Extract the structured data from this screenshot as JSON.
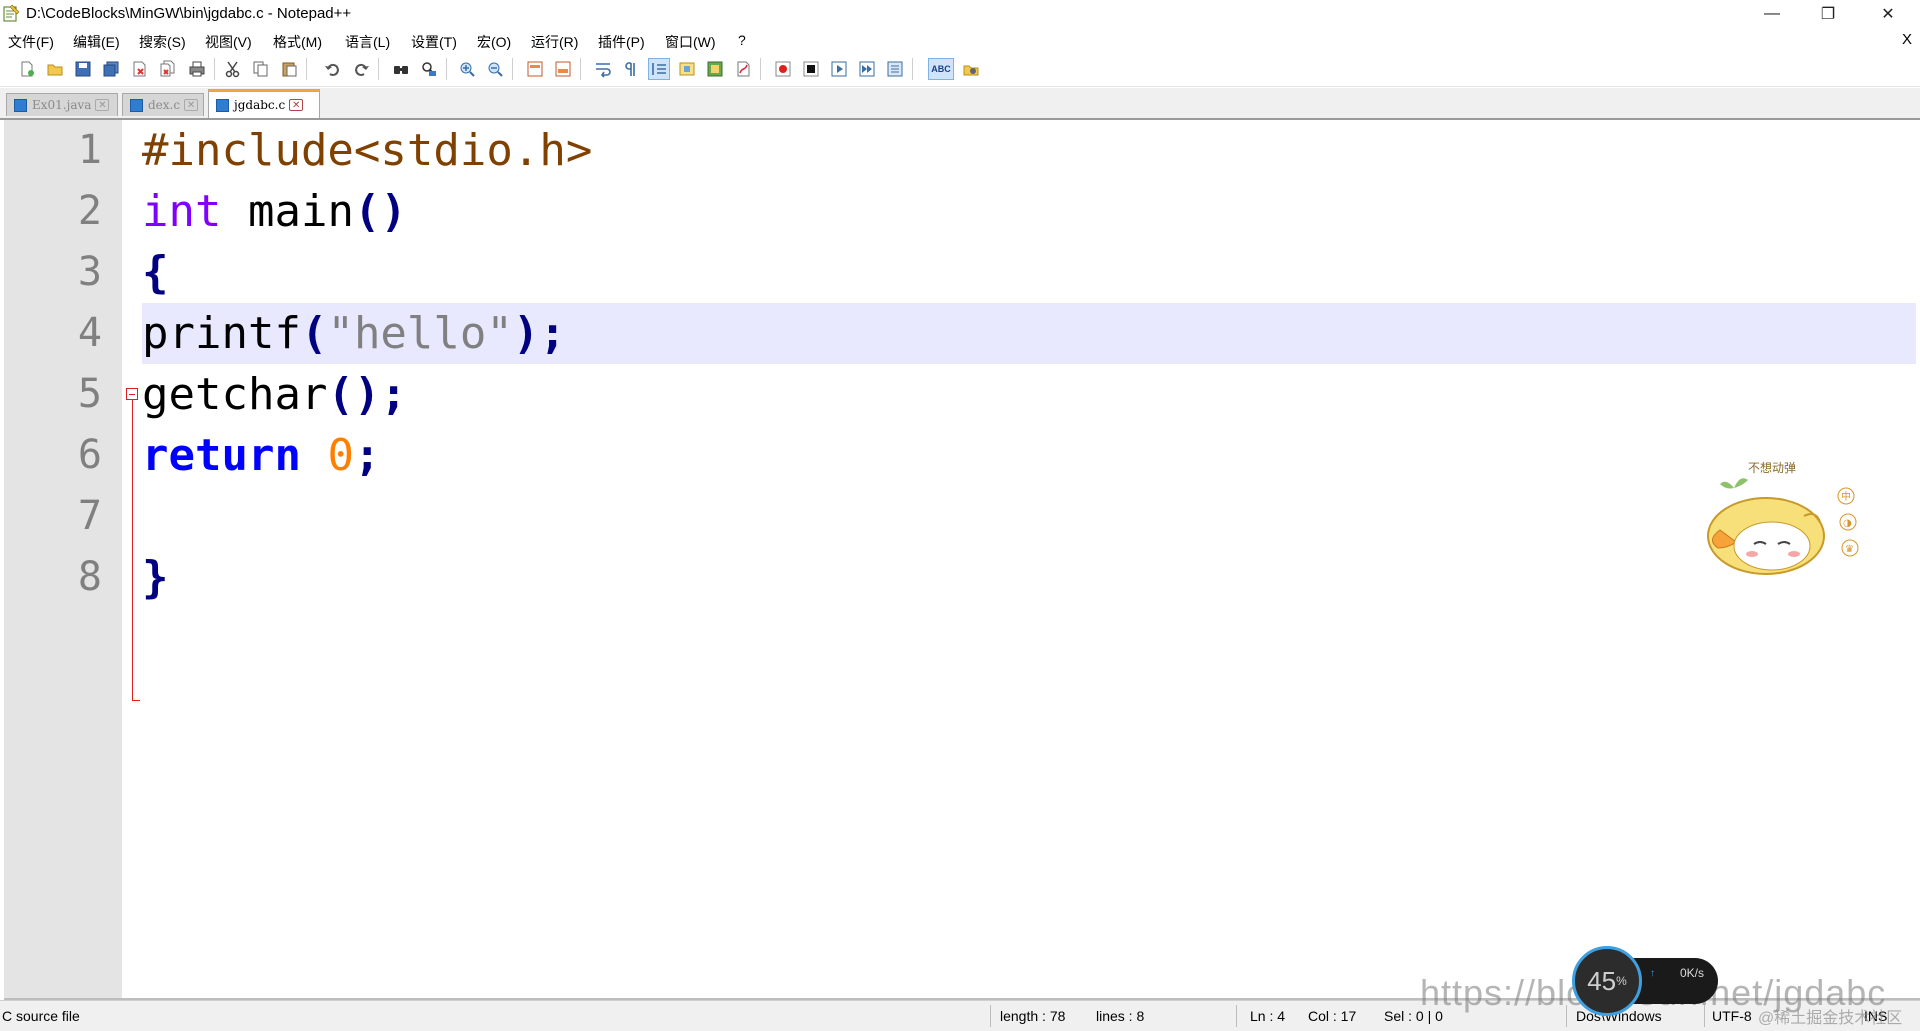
{
  "window": {
    "title": "D:\\CodeBlocks\\MinGW\\bin\\jgdabc.c - Notepad++",
    "minimize_glyph": "—",
    "restore_glyph": "❐",
    "close_glyph": "✕"
  },
  "menu": {
    "items": [
      "文件(F)",
      "编辑(E)",
      "搜索(S)",
      "视图(V)",
      "格式(M)",
      "语言(L)",
      "设置(T)",
      "宏(O)",
      "运行(R)",
      "插件(P)",
      "窗口(W)",
      "?"
    ],
    "close_label": "X"
  },
  "toolbar": {
    "icons": [
      "new-file-icon",
      "open-file-icon",
      "save-icon",
      "save-all-icon",
      "close-icon",
      "close-all-icon",
      "print-icon",
      "cut-icon",
      "copy-icon",
      "paste-icon",
      "undo-icon",
      "redo-icon",
      "find-icon",
      "replace-icon",
      "zoom-in-icon",
      "zoom-out-icon",
      "sync-vertical-icon",
      "sync-horizontal-icon",
      "word-wrap-icon",
      "show-all-characters-icon",
      "indent-guide-icon",
      "doc-map-icon",
      "function-list-icon",
      "folder-as-workspace-icon",
      "record-macro-icon",
      "stop-record-icon",
      "playback-icon",
      "run-macro-multiple-icon",
      "save-macro-icon",
      "spell-check-icon",
      "launch-browser-icon"
    ],
    "spell_check_label": "ABC"
  },
  "tabs": [
    {
      "label": "Ex01.java",
      "active": false
    },
    {
      "label": "dex.c",
      "active": false
    },
    {
      "label": "jgdabc.c",
      "active": true
    }
  ],
  "tab_close_glyph": "✕",
  "editor": {
    "lines": [
      {
        "num": "1",
        "tokens": [
          {
            "t": "#include<stdio.h>",
            "c": "prep"
          }
        ]
      },
      {
        "num": "2",
        "tokens": [
          {
            "t": "int",
            "c": "type"
          },
          {
            "t": " main",
            "c": "def"
          },
          {
            "t": "()",
            "c": "op"
          }
        ]
      },
      {
        "num": "3",
        "tokens": [
          {
            "t": "{",
            "c": "op"
          }
        ]
      },
      {
        "num": "4",
        "tokens": [
          {
            "t": "printf",
            "c": "def"
          },
          {
            "t": "(",
            "c": "op"
          },
          {
            "t": "\"hello\"",
            "c": "str"
          },
          {
            "t": ");",
            "c": "op"
          }
        ]
      },
      {
        "num": "5",
        "tokens": [
          {
            "t": "getchar",
            "c": "def"
          },
          {
            "t": "();",
            "c": "op"
          }
        ]
      },
      {
        "num": "6",
        "tokens": [
          {
            "t": "return",
            "c": "kw"
          },
          {
            "t": " ",
            "c": "def"
          },
          {
            "t": "0",
            "c": "num"
          },
          {
            "t": ";",
            "c": "op"
          }
        ]
      },
      {
        "num": "7",
        "tokens": []
      },
      {
        "num": "8",
        "tokens": [
          {
            "t": "}",
            "c": "op"
          }
        ]
      }
    ],
    "current_line": 4,
    "colors": {
      "preprocessor": "#804000",
      "type": "#8000ff",
      "keyword": "#0000ff",
      "operator": "#000080",
      "string": "#808080",
      "number": "#ff8000",
      "current_line_bg": "#e8e8ff"
    }
  },
  "sticker": {
    "caption": "不想动弹",
    "badges": [
      "中",
      "◑",
      "♛"
    ]
  },
  "status": {
    "file_type": "C source file",
    "length": "length : 78",
    "lines": "lines : 8",
    "ln": "Ln : 4",
    "col": "Col : 17",
    "sel": "Sel : 0 | 0",
    "eol": "Dos\\Windows",
    "encoding": "UTF-8",
    "mode": "INS"
  },
  "speed_widget": {
    "percent": "45",
    "percent_sign": "%",
    "rate": "0K/s",
    "arrow": "↑"
  },
  "watermark": {
    "url": "https://blog.csdn.net/jgdabc",
    "credit": "@稀土掘金技术社区"
  }
}
